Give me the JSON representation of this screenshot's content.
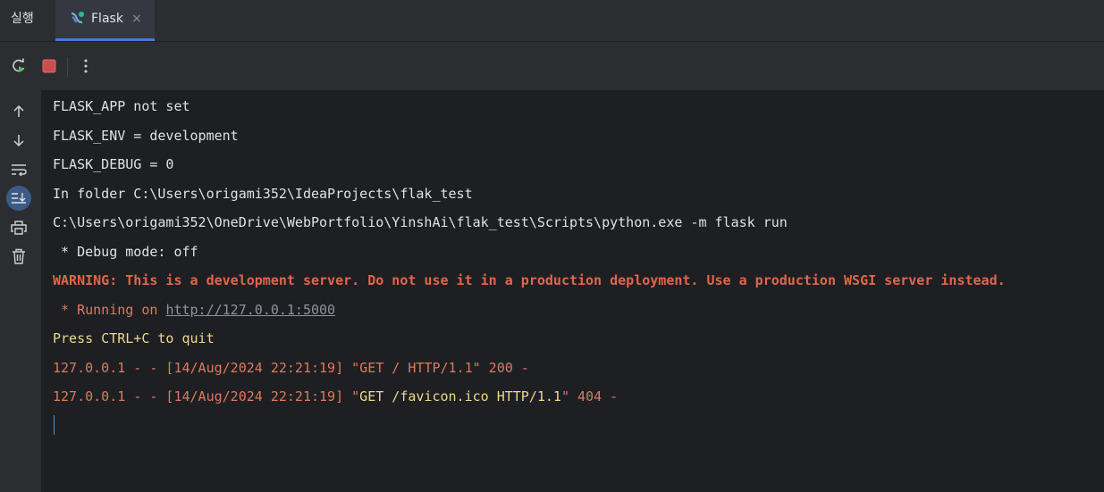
{
  "tabbar": {
    "title": "실행",
    "tab_label": "Flask",
    "close_glyph": "×"
  },
  "icons": {
    "rerun": "rerun-icon",
    "stop": "stop-icon",
    "more": "more-vertical-icon",
    "scroll_up": "arrow-up-icon",
    "scroll_down": "arrow-down-icon",
    "soft_wrap": "soft-wrap-icon",
    "scroll_to_end": "scroll-to-end-icon",
    "print": "print-icon",
    "clear": "trash-icon"
  },
  "colors": {
    "accent": "#4a78d5",
    "warning": "#e0664b",
    "log_orange": "#dc7a5e",
    "log_yellow": "#f0d78a",
    "stop_red": "#c94f4f"
  },
  "console": {
    "line1": "FLASK_APP not set",
    "line2": "FLASK_ENV = development",
    "line3": "FLASK_DEBUG = 0",
    "line4": "In folder C:\\Users\\origami352\\IdeaProjects\\flak_test",
    "line5": "C:\\Users\\origami352\\OneDrive\\WebPortfolio\\YinshAi\\flak_test\\Scripts\\python.exe -m flask run",
    "line6": " * Debug mode: off",
    "line7": "WARNING: This is a development server. Do not use it in a production deployment. Use a production WSGI server instead.",
    "line8_prefix": " * Running on ",
    "line8_link": "http://127.0.0.1:5000",
    "line9": "Press CTRL+C to quit",
    "line10": "127.0.0.1 - - [14/Aug/2024 22:21:19] \"GET / HTTP/1.1\" 200 -",
    "line11_a": "127.0.0.1 - - [14/Aug/2024 22:21:19] \"",
    "line11_b": "GET /favicon.ico HTTP/1.1",
    "line11_c": "\" 404 -"
  }
}
